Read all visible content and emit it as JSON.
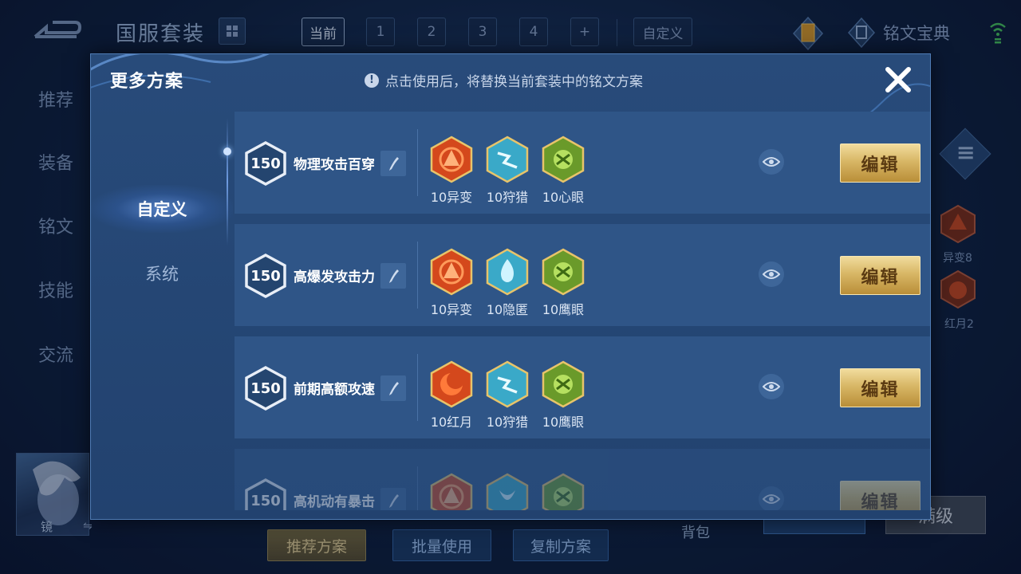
{
  "background": {
    "title": "国服套装",
    "slot_tabs": [
      "当前",
      "1",
      "2",
      "3",
      "4",
      "+",
      "自定义"
    ],
    "rune_book_label": "铭文宝典",
    "side_nav": [
      "推荐",
      "装备",
      "铭文",
      "技能",
      "交流"
    ],
    "right_runes": [
      "异变8",
      "红月2"
    ],
    "hero_name": "镜",
    "swap_icon": "⇋",
    "bottom_buttons": {
      "recommend": "推荐方案",
      "batch_use": "批量使用",
      "copy": "复制方案"
    },
    "bag_label": "背包",
    "max_level": "满级"
  },
  "dialog": {
    "title": "更多方案",
    "hint": "点击使用后，将替换当前套装中的铭文方案",
    "info_icon_glyph": "!",
    "tabs": [
      {
        "label": "自定义",
        "active": true
      },
      {
        "label": "系统",
        "active": false
      }
    ],
    "edit_label": "编辑",
    "plans": [
      {
        "level": "150",
        "name": "物理攻击百穿",
        "runes": [
          {
            "label": "10异变",
            "icon": "red-rune-icon",
            "color": "#d4481c"
          },
          {
            "label": "10狩猎",
            "icon": "blue-lightning-rune-icon",
            "color": "#3aa9c8"
          },
          {
            "label": "10心眼",
            "icon": "green-rune-icon",
            "color": "#6a9a2a"
          }
        ]
      },
      {
        "level": "150",
        "name": "高爆发攻击力",
        "runes": [
          {
            "label": "10异变",
            "icon": "red-rune-icon",
            "color": "#d4481c"
          },
          {
            "label": "10隐匿",
            "icon": "blue-flame-rune-icon",
            "color": "#3aa9c8"
          },
          {
            "label": "10鹰眼",
            "icon": "green-rune-icon",
            "color": "#6a9a2a"
          }
        ]
      },
      {
        "level": "150",
        "name": "前期高额攻速",
        "runes": [
          {
            "label": "10红月",
            "icon": "red-moon-rune-icon",
            "color": "#d4481c"
          },
          {
            "label": "10狩猎",
            "icon": "blue-lightning-rune-icon",
            "color": "#3aa9c8"
          },
          {
            "label": "10鹰眼",
            "icon": "green-rune-icon",
            "color": "#6a9a2a"
          }
        ]
      },
      {
        "level": "150",
        "name": "高机动有暴击",
        "runes": [
          {
            "label": "",
            "icon": "red-rune-icon",
            "color": "#d4481c"
          },
          {
            "label": "",
            "icon": "blue-rune-icon",
            "color": "#3aa9c8"
          },
          {
            "label": "",
            "icon": "green-rune-icon",
            "color": "#6a9a2a"
          }
        ]
      }
    ]
  }
}
